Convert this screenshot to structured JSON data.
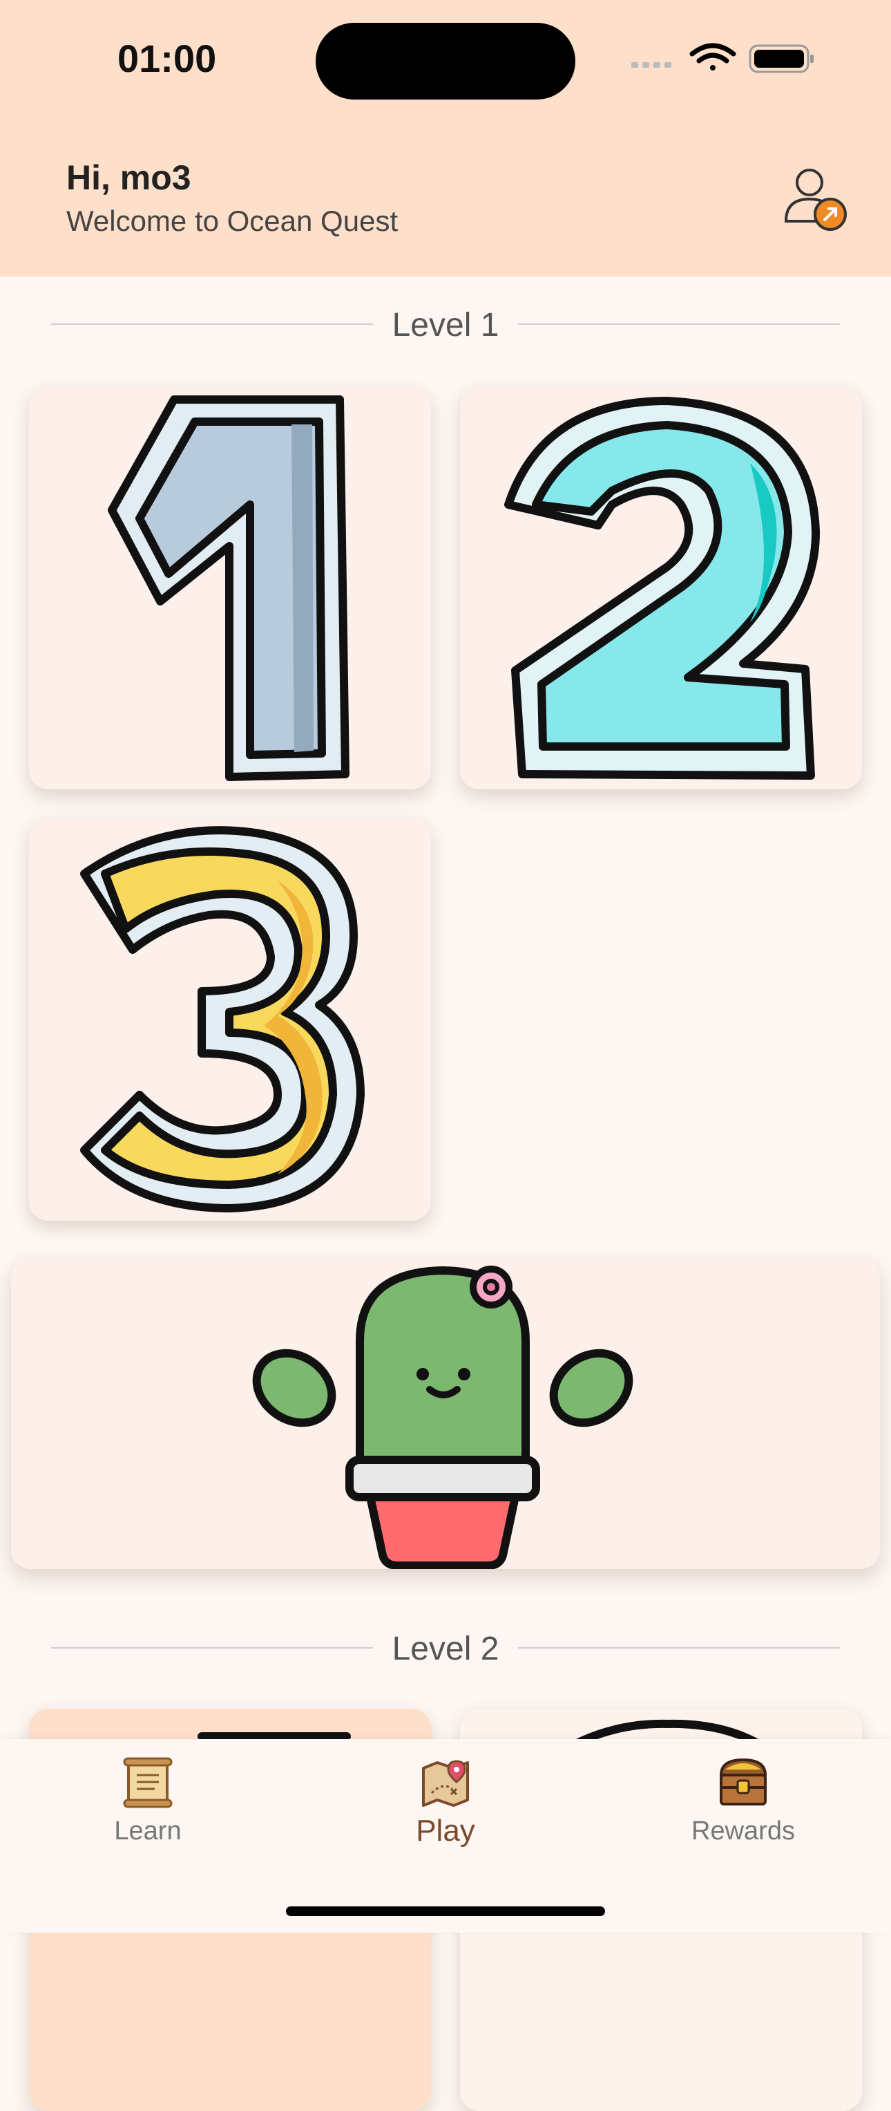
{
  "status": {
    "time": "01:00"
  },
  "header": {
    "greeting": "Hi, mo3",
    "subtitle": "Welcome to Ocean Quest",
    "profile_icon": "user-share-icon"
  },
  "levels": [
    {
      "label": "Level 1",
      "cards": [
        "1",
        "2",
        "3"
      ],
      "banner": "cactus-icon"
    },
    {
      "label": "Level 2"
    }
  ],
  "tabs": [
    {
      "label": "Learn",
      "icon": "scroll-icon",
      "active": false
    },
    {
      "label": "Play",
      "icon": "treasure-map-icon",
      "active": true
    },
    {
      "label": "Rewards",
      "icon": "treasure-chest-icon",
      "active": false
    }
  ],
  "colors": {
    "header_bg": "#fedfca",
    "page_bg": "#fdf6f2",
    "card_bg": "#fdf0ea",
    "accent": "#f08a24"
  }
}
